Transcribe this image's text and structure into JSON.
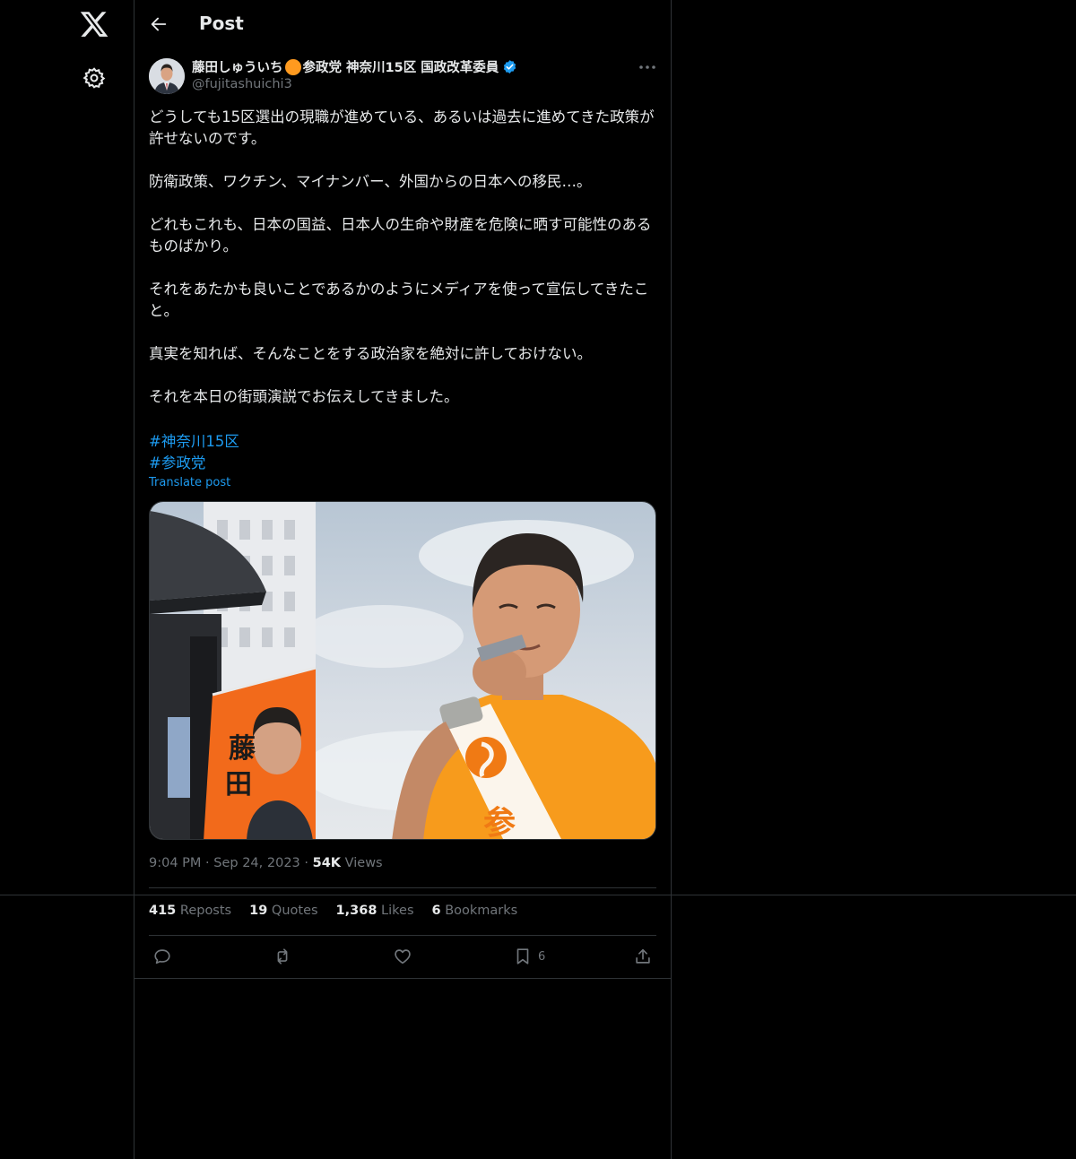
{
  "header": {
    "title": "Post"
  },
  "author": {
    "name_part1": "藤田しゅういち",
    "name_part2": "参政党 神奈川15区 国政改革委員",
    "handle": "@fujitashuichi3"
  },
  "post": {
    "body": "どうしても15区選出の現職が進めている、あるいは過去に進めてきた政策が許せないのです。\n\n防衛政策、ワクチン、マイナンバー、外国からの日本への移民…。\n\nどれもこれも、日本の国益、日本人の生命や財産を危険に晒す可能性のあるものばかり。\n\nそれをあたかも良いことであるかのようにメディアを使って宣伝してきたこと。\n\n真実を知れば、そんなことをする政治家を絶対に許しておけない。\n\nそれを本日の街頭演説でお伝えしてきました。",
    "hashtags": [
      "#神奈川15区",
      "#参政党"
    ],
    "translate_label": "Translate post",
    "time": "9:04 PM",
    "date": "Sep 24, 2023",
    "views_count": "54K",
    "views_label": "Views"
  },
  "stats": {
    "reposts_count": "415",
    "reposts_label": "Reposts",
    "quotes_count": "19",
    "quotes_label": "Quotes",
    "likes_count": "1,368",
    "likes_label": "Likes",
    "bookmarks_count": "6",
    "bookmarks_label": "Bookmarks"
  },
  "actions": {
    "bookmark_count": "6"
  },
  "media": {
    "poster_text_1": "藤",
    "poster_text_2": "田",
    "sash_text": "参"
  },
  "colors": {
    "background": "#000000",
    "text": "#e7e9ea",
    "muted": "#71767b",
    "link": "#1d9bf0",
    "border": "#2f3336",
    "orange": "#ff9a1f"
  },
  "icons": [
    "x-logo-icon",
    "gear-icon",
    "back-arrow-icon",
    "verified-badge-icon",
    "more-icon",
    "reply-icon",
    "repost-icon",
    "like-icon",
    "bookmark-icon",
    "share-icon"
  ]
}
